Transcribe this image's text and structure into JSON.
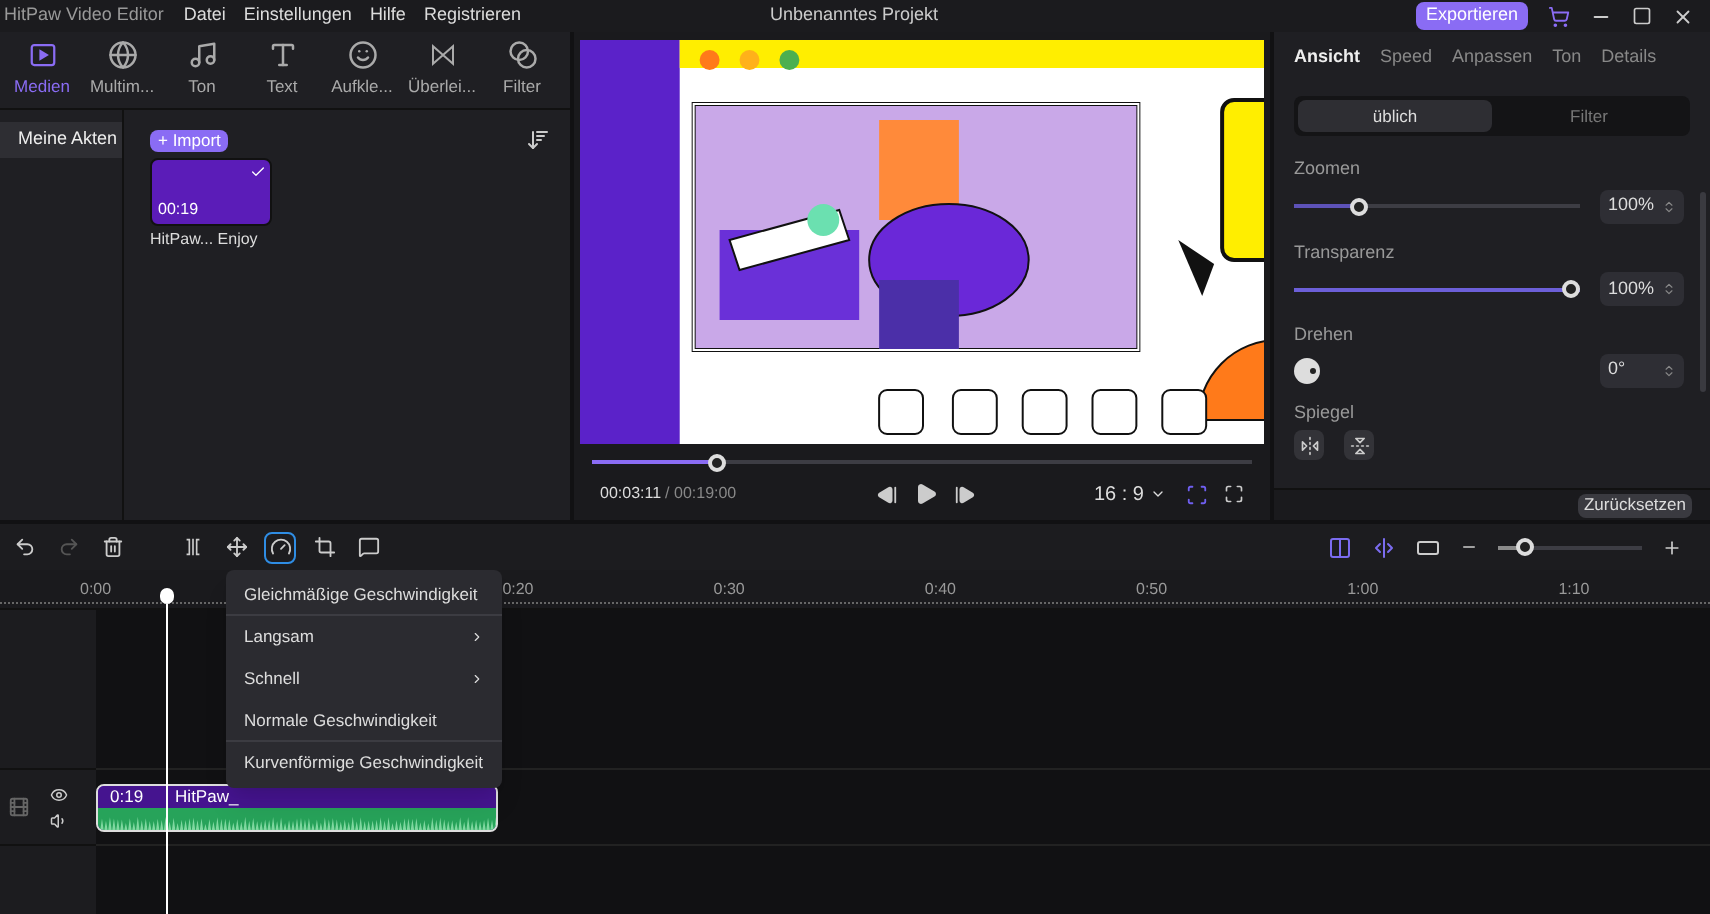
{
  "window": {
    "app_name": "HitPaw Video Editor",
    "title": "Unbenanntes Projekt",
    "export_button": "Exportieren"
  },
  "menu": [
    "Datei",
    "Einstellungen",
    "Hilfe",
    "Registrieren"
  ],
  "media_tabs": [
    {
      "label": "Medien",
      "kind": "media",
      "selected": true
    },
    {
      "label": "Multim...",
      "kind": "globe",
      "selected": false
    },
    {
      "label": "Ton",
      "kind": "music",
      "selected": false
    },
    {
      "label": "Text",
      "kind": "text",
      "selected": false
    },
    {
      "label": "Aufkle...",
      "kind": "smile",
      "selected": false
    },
    {
      "label": "Überlei...",
      "kind": "transition",
      "selected": false
    },
    {
      "label": "Filter",
      "kind": "filter",
      "selected": false
    }
  ],
  "sidebar": {
    "items": [
      {
        "label": "Meine Akten",
        "selected": true
      }
    ]
  },
  "library": {
    "import_button": "+ Import",
    "items": [
      {
        "name": "HitPaw... Enjoy",
        "duration": "00:19",
        "checked": true
      }
    ]
  },
  "preview": {
    "progress": {
      "level": 0.18
    },
    "current_time": "00:03:11",
    "total_time": "/ 00:19:00",
    "aspect_ratio": "16 : 9"
  },
  "properties": {
    "tabs": [
      {
        "label": "Ansicht",
        "selected": true
      },
      {
        "label": "Speed",
        "selected": false
      },
      {
        "label": "Anpassen",
        "selected": false
      },
      {
        "label": "Ton",
        "selected": false
      },
      {
        "label": "Details",
        "selected": false
      }
    ],
    "modes": [
      {
        "label": "üblich",
        "selected": true
      },
      {
        "label": "Filter",
        "selected": false
      }
    ],
    "zoom": {
      "label": "Zoomen",
      "level": 0.21,
      "value": "100%"
    },
    "opacity": {
      "label": "Transparenz",
      "level": 1,
      "value": "100%"
    },
    "rotate": {
      "label": "Drehen",
      "value": "0°"
    },
    "mirror": {
      "label": "Spiegel"
    },
    "reset_button": "Zurücksetzen"
  },
  "timeline": {
    "tools": [
      {
        "kind": "undo",
        "disabled": false,
        "selected": false
      },
      {
        "kind": "redo",
        "disabled": true,
        "selected": false
      },
      {
        "kind": "delete",
        "disabled": false,
        "selected": false
      },
      {
        "kind": "split",
        "disabled": false,
        "selected": false
      },
      {
        "kind": "move",
        "disabled": false,
        "selected": false
      },
      {
        "kind": "speed",
        "disabled": false,
        "selected": true
      },
      {
        "kind": "crop",
        "disabled": false,
        "selected": false
      },
      {
        "kind": "marker",
        "disabled": false,
        "selected": false
      }
    ],
    "zoom": {
      "level": 0.15
    },
    "ruler": [
      "0:00",
      "0:20",
      "0:30",
      "0:40",
      "0:50",
      "1:00",
      "1:10"
    ],
    "clip": {
      "duration": "0:19",
      "name": "HitPaw_"
    },
    "speed_menu": [
      {
        "label": "Gleichmäßige Geschwindigkeit",
        "submenu": false,
        "divider_after": true
      },
      {
        "label": "Langsam",
        "submenu": true,
        "divider_after": false
      },
      {
        "label": "Schnell",
        "submenu": true,
        "divider_after": false
      },
      {
        "label": "Normale Geschwindigkeit",
        "submenu": false,
        "divider_after": true
      },
      {
        "label": "Kurvenförmige  Geschwindigkeit",
        "submenu": false,
        "divider_after": false
      }
    ]
  }
}
